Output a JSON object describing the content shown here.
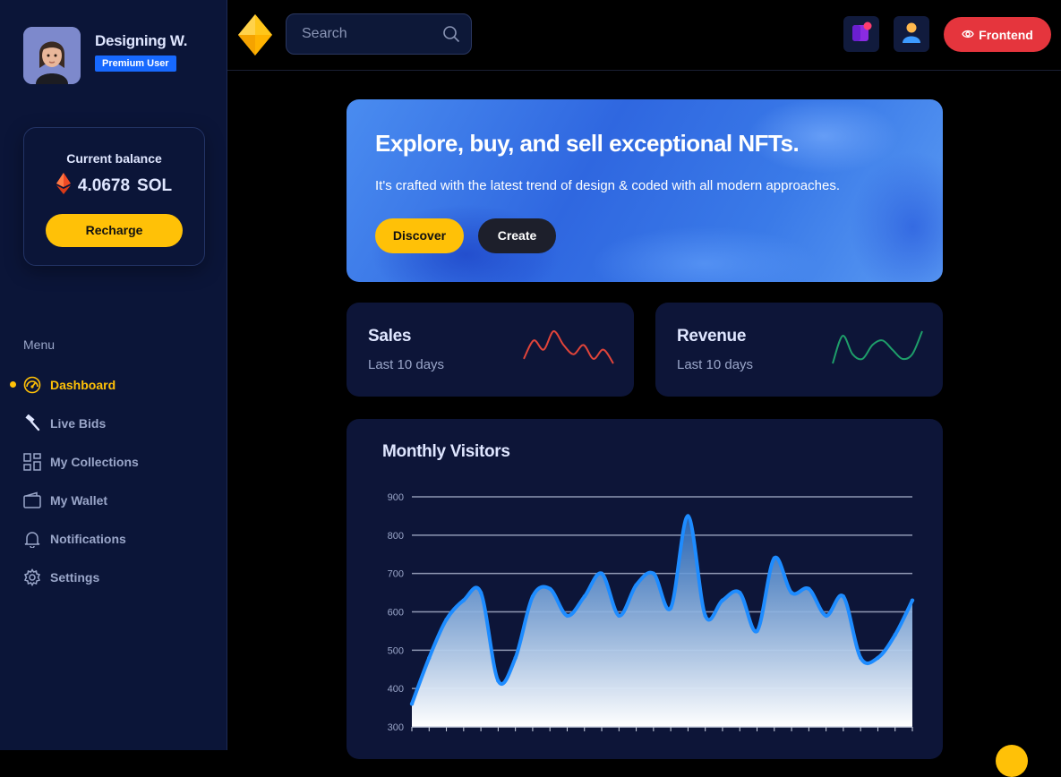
{
  "profile": {
    "name": "Designing W.",
    "badge": "Premium User"
  },
  "balance": {
    "label": "Current balance",
    "amount": "4.0678",
    "currency": "SOL",
    "recharge_label": "Recharge"
  },
  "menu": {
    "title": "Menu",
    "items": [
      {
        "label": "Dashboard",
        "icon": "dashboard-icon",
        "active": true
      },
      {
        "label": "Live Bids",
        "icon": "hammer-icon"
      },
      {
        "label": "My Collections",
        "icon": "grid-icon"
      },
      {
        "label": "My Wallet",
        "icon": "wallet-icon"
      },
      {
        "label": "Notifications",
        "icon": "bell-icon"
      },
      {
        "label": "Settings",
        "icon": "gear-icon"
      }
    ]
  },
  "topbar": {
    "search_placeholder": "Search",
    "frontend_label": "Frontend"
  },
  "hero": {
    "title": "Explore, buy, and sell exceptional NFTs.",
    "subtitle": "It's crafted with the latest trend of design & coded with all modern approaches.",
    "discover_label": "Discover",
    "create_label": "Create"
  },
  "stats": [
    {
      "title": "Sales",
      "subtitle": "Last 10 days",
      "color": "#e0443a",
      "values": [
        3,
        7,
        5,
        9,
        6,
        4,
        6,
        3,
        5,
        2
      ]
    },
    {
      "title": "Revenue",
      "subtitle": "Last 10 days",
      "color": "#1e9e6a",
      "values": [
        2,
        8,
        4,
        3,
        6,
        7,
        5,
        3,
        4,
        9
      ]
    }
  ],
  "colors": {
    "accent": "#ffc107",
    "danger": "#e5353d",
    "brand_blue": "#1769ff",
    "sidebar_bg": "#0b1538"
  },
  "chart_data": {
    "type": "area",
    "title": "Monthly Visitors",
    "xlabel": "",
    "ylabel": "",
    "ylim": [
      300,
      900
    ],
    "yticks": [
      300,
      400,
      500,
      600,
      700,
      800,
      900
    ],
    "grid": true,
    "series": [
      {
        "values": [
          360,
          480,
          580,
          630,
          650,
          420,
          480,
          640,
          660,
          590,
          640,
          700,
          590,
          670,
          700,
          610,
          850,
          590,
          630,
          650,
          550,
          740,
          650,
          660,
          590,
          640,
          480,
          480,
          540,
          630
        ]
      }
    ]
  }
}
